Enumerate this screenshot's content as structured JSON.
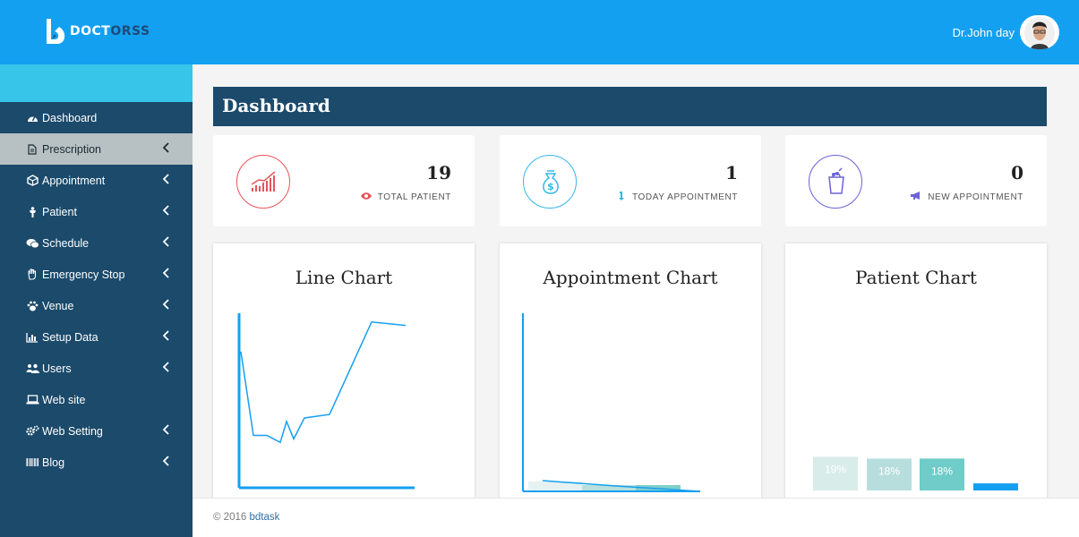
{
  "brand": {
    "name_part1": "DOCT",
    "name_part2": "ORSS"
  },
  "user": {
    "name": "Dr.John day"
  },
  "sidebar": {
    "items": [
      {
        "label": "Dashboard",
        "icon": "dashboard-icon",
        "has_submenu": false,
        "active": false
      },
      {
        "label": "Prescription",
        "icon": "file-icon",
        "has_submenu": true,
        "active": true
      },
      {
        "label": "Appointment",
        "icon": "cube-icon",
        "has_submenu": true,
        "active": false
      },
      {
        "label": "Patient",
        "icon": "person-icon",
        "has_submenu": true,
        "active": false
      },
      {
        "label": "Schedule",
        "icon": "chat-icon",
        "has_submenu": true,
        "active": false
      },
      {
        "label": "Emergency Stop",
        "icon": "hand-icon",
        "has_submenu": true,
        "active": false
      },
      {
        "label": "Venue",
        "icon": "paw-icon",
        "has_submenu": true,
        "active": false
      },
      {
        "label": "Setup Data",
        "icon": "bar-chart-icon",
        "has_submenu": true,
        "active": false
      },
      {
        "label": "Users",
        "icon": "users-icon",
        "has_submenu": true,
        "active": false
      },
      {
        "label": "Web site",
        "icon": "laptop-icon",
        "has_submenu": false,
        "active": false
      },
      {
        "label": "Web Setting",
        "icon": "gears-icon",
        "has_submenu": true,
        "active": false
      },
      {
        "label": "Blog",
        "icon": "barcode-icon",
        "has_submenu": true,
        "active": false
      }
    ]
  },
  "page": {
    "title": "Dashboard"
  },
  "stats": [
    {
      "value": "19",
      "label": "TOTAL PATIENT",
      "icon": "eye-icon",
      "badge_icon": "line-graph-icon",
      "color": "#e8545a"
    },
    {
      "value": "1",
      "label": "TODAY APPOINTMENT",
      "icon": "arrow-down-icon",
      "badge_icon": "money-bag-icon",
      "color": "#35b7e8"
    },
    {
      "value": "0",
      "label": "NEW APPOINTMENT",
      "icon": "bullhorn-icon",
      "badge_icon": "shopping-bag-icon",
      "color": "#6b63d9"
    }
  ],
  "charts": [
    {
      "title": "Line Chart"
    },
    {
      "title": "Appointment Chart"
    },
    {
      "title": "Patient Chart"
    }
  ],
  "chart_data": [
    {
      "type": "line",
      "title": "Line Chart",
      "x": [
        0,
        1,
        2,
        3,
        4,
        5,
        6,
        7,
        8,
        9,
        10
      ],
      "values": [
        78,
        30,
        30,
        26,
        38,
        28,
        40,
        42,
        95,
        93
      ],
      "ylim": [
        0,
        100
      ],
      "color": "#14a0f0"
    },
    {
      "type": "line",
      "title": "Appointment Chart",
      "x": [
        0,
        1,
        2
      ],
      "values": [
        6,
        3,
        0
      ],
      "ylim": [
        0,
        100
      ],
      "color": "#14a0f0"
    },
    {
      "type": "bar",
      "title": "Patient Chart",
      "categories": [
        "",
        "",
        "",
        ""
      ],
      "values": [
        19,
        18,
        18,
        4
      ],
      "data_labels": [
        "19%",
        "18%",
        "18%",
        ""
      ],
      "colors": [
        "#d8ecea",
        "#b7dedd",
        "#6fccc8",
        "#14a0f0"
      ],
      "ylim": [
        0,
        100
      ]
    }
  ],
  "footer": {
    "copyright": "© 2016 ",
    "link": "bdtask"
  }
}
